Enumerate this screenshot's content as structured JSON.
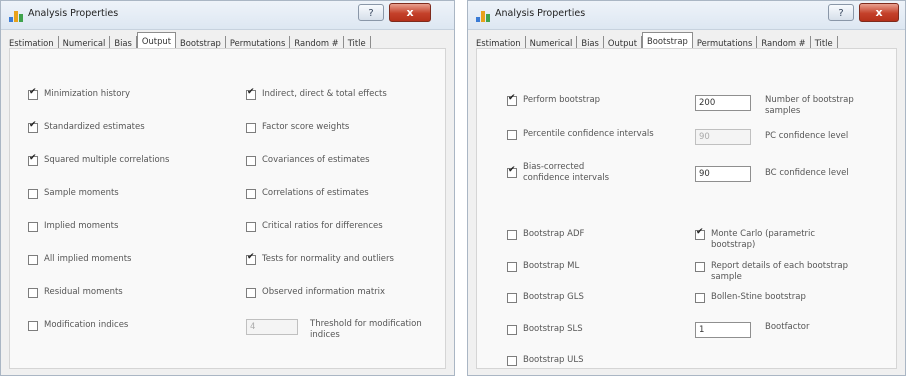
{
  "left": {
    "title": "Analysis Properties",
    "help": "?",
    "close": "x",
    "tabs": [
      "Estimation",
      "Numerical",
      "Bias",
      "Output",
      "Bootstrap",
      "Permutations",
      "Random #",
      "Title"
    ],
    "active_tab": "Output",
    "col1": [
      {
        "label": "Minimization history",
        "checked": true
      },
      {
        "label": "Standardized estimates",
        "checked": true
      },
      {
        "label": "Squared multiple correlations",
        "checked": true
      },
      {
        "label": "Sample moments",
        "checked": false
      },
      {
        "label": "Implied moments",
        "checked": false
      },
      {
        "label": "All implied moments",
        "checked": false
      },
      {
        "label": "Residual moments",
        "checked": false
      },
      {
        "label": "Modification indices",
        "checked": false
      }
    ],
    "col2": [
      {
        "label": "Indirect, direct & total effects",
        "checked": true
      },
      {
        "label": "Factor score weights",
        "checked": false
      },
      {
        "label": "Covariances of estimates",
        "checked": false
      },
      {
        "label": "Correlations of estimates",
        "checked": false
      },
      {
        "label": "Critical ratios for differences",
        "checked": false
      },
      {
        "label": "Tests for normality and outliers",
        "checked": true
      },
      {
        "label": "Observed information matrix",
        "checked": false
      }
    ],
    "threshold": {
      "value": "4",
      "label": "Threshold for modification indices"
    }
  },
  "right": {
    "title": "Analysis Properties",
    "help": "?",
    "close": "x",
    "tabs": [
      "Estimation",
      "Numerical",
      "Bias",
      "Output",
      "Bootstrap",
      "Permutations",
      "Random #",
      "Title"
    ],
    "active_tab": "Bootstrap",
    "perform": {
      "label": "Perform bootstrap",
      "checked": true,
      "value": "200",
      "side_label": "Number of bootstrap samples"
    },
    "percentile": {
      "label": "Percentile confidence intervals",
      "checked": false,
      "value": "90",
      "side_label": "PC confidence level"
    },
    "bias_corrected": {
      "label": "Bias-corrected confidence intervals",
      "checked": true,
      "value": "90",
      "side_label": "BC confidence level"
    },
    "col1": [
      {
        "label": "Bootstrap ADF",
        "checked": false
      },
      {
        "label": "Bootstrap ML",
        "checked": false
      },
      {
        "label": "Bootstrap GLS",
        "checked": false
      },
      {
        "label": "Bootstrap SLS",
        "checked": false
      },
      {
        "label": "Bootstrap ULS",
        "checked": false
      }
    ],
    "col2": [
      {
        "label": "Monte Carlo (parametric bootstrap)",
        "checked": true
      },
      {
        "label": "Report details of each bootstrap sample",
        "checked": false
      },
      {
        "label": "Bollen-Stine bootstrap",
        "checked": false
      }
    ],
    "bootfactor": {
      "value": "1",
      "label": "Bootfactor"
    }
  }
}
